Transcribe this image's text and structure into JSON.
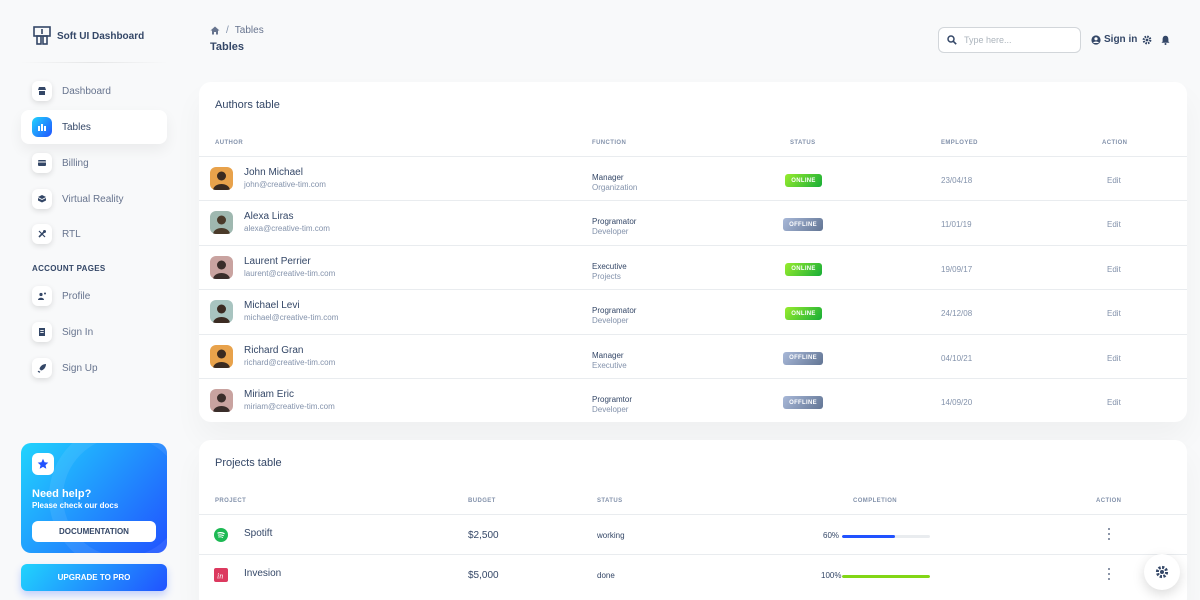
{
  "brand": {
    "name": "Soft UI Dashboard"
  },
  "sidebar": {
    "items": [
      {
        "label": "Dashboard",
        "icon": "shop-icon"
      },
      {
        "label": "Tables",
        "icon": "office-icon"
      },
      {
        "label": "Billing",
        "icon": "credit-card-icon"
      },
      {
        "label": "Virtual Reality",
        "icon": "box-3d-icon"
      },
      {
        "label": "RTL",
        "icon": "settings-tools-icon"
      }
    ],
    "section_label": "ACCOUNT PAGES",
    "account_items": [
      {
        "label": "Profile",
        "icon": "customer-support-icon"
      },
      {
        "label": "Sign In",
        "icon": "document-icon"
      },
      {
        "label": "Sign Up",
        "icon": "spaceship-icon"
      }
    ]
  },
  "help_card": {
    "title": "Need help?",
    "subtitle": "Please check our docs",
    "button": "DOCUMENTATION"
  },
  "upgrade_button": "UPGRADE TO PRO",
  "header": {
    "breadcrumb_current": "Tables",
    "page_title": "Tables",
    "search_placeholder": "Type here...",
    "signin_label": "Sign in"
  },
  "authors_table": {
    "title": "Authors table",
    "columns": [
      "AUTHOR",
      "FUNCTION",
      "STATUS",
      "EMPLOYED",
      "ACTION"
    ],
    "rows": [
      {
        "name": "John Michael",
        "email": "john@creative-tim.com",
        "function": "Manager",
        "department": "Organization",
        "status": "ONLINE",
        "employed": "23/04/18",
        "action": "Edit"
      },
      {
        "name": "Alexa Liras",
        "email": "alexa@creative-tim.com",
        "function": "Programator",
        "department": "Developer",
        "status": "OFFLINE",
        "employed": "11/01/19",
        "action": "Edit"
      },
      {
        "name": "Laurent Perrier",
        "email": "laurent@creative-tim.com",
        "function": "Executive",
        "department": "Projects",
        "status": "ONLINE",
        "employed": "19/09/17",
        "action": "Edit"
      },
      {
        "name": "Michael Levi",
        "email": "michael@creative-tim.com",
        "function": "Programator",
        "department": "Developer",
        "status": "ONLINE",
        "employed": "24/12/08",
        "action": "Edit"
      },
      {
        "name": "Richard Gran",
        "email": "richard@creative-tim.com",
        "function": "Manager",
        "department": "Executive",
        "status": "OFFLINE",
        "employed": "04/10/21",
        "action": "Edit"
      },
      {
        "name": "Miriam Eric",
        "email": "miriam@creative-tim.com",
        "function": "Programtor",
        "department": "Developer",
        "status": "OFFLINE",
        "employed": "14/09/20",
        "action": "Edit"
      }
    ]
  },
  "projects_table": {
    "title": "Projects table",
    "columns": [
      "PROJECT",
      "BUDGET",
      "STATUS",
      "COMPLETION",
      "ACTION"
    ],
    "rows": [
      {
        "project": "Spotift",
        "icon": "spotify-icon",
        "budget": "$2,500",
        "status": "working",
        "completion_label": "60%",
        "completion": 0.6,
        "bar_color": "#2152ff"
      },
      {
        "project": "Invesion",
        "icon": "invision-icon",
        "budget": "$5,000",
        "status": "done",
        "completion_label": "100%",
        "completion": 1.0,
        "bar_color": "#82d616"
      }
    ]
  },
  "colors": {
    "accent": "#2152ff",
    "online": "#82d616",
    "offline": "#8392ab",
    "text": "#344767"
  }
}
